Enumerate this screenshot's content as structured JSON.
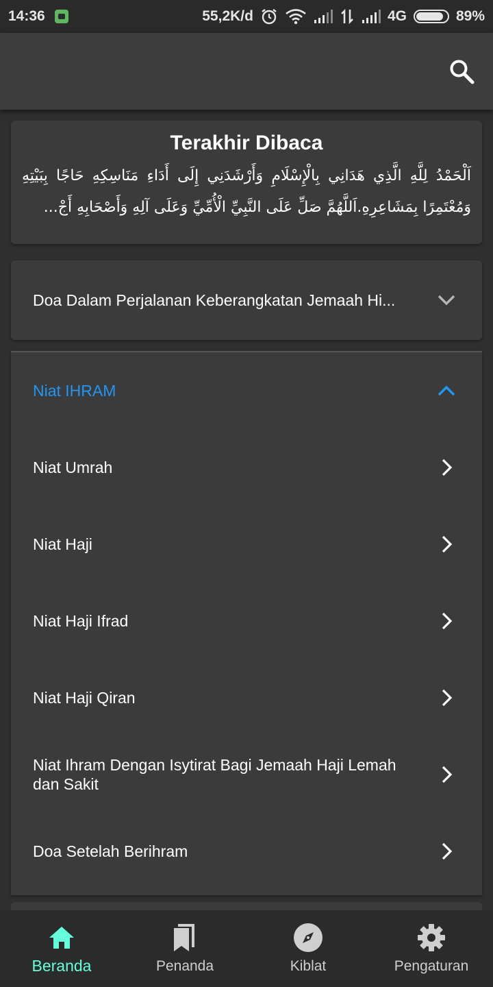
{
  "status_bar": {
    "time": "14:36",
    "network_speed": "55,2K/d",
    "network_type": "4G",
    "battery_percent": "89%",
    "battery_level": 0.89,
    "icons": [
      "app-notification-icon",
      "alarm-icon",
      "wifi-icon",
      "signal-icon",
      "data-transfer-icon",
      "signal-icon",
      "battery-icon"
    ]
  },
  "app_bar": {
    "search_icon": "search-icon"
  },
  "last_read": {
    "title": "Terakhir Dibaca",
    "text": "اَلْحَمْدُ لِلَّهِ الَّذِي هَدَانِي بِالْإِسْلَامِ وَأَرْشَدَنِي إِلَى أَدَاءِ مَنَاسِكِهِ حَاجًا بِبَيْتِهِ وَمُعْتَمِرًا بِمَشَاعِرِهِ.اَللَّهُمَّ صَلِّ عَلَى النَّبِيِّ الْأُمِّيِّ وَعَلَى آلِهِ وَأَصْحَابِهِ أَجْ..."
  },
  "sections": [
    {
      "title": "Doa Dalam Perjalanan Keberangkatan Jemaah Hi...",
      "expanded": false
    },
    {
      "title": "Niat IHRAM",
      "expanded": true,
      "accent_color": "#2196f3",
      "items": [
        "Niat Umrah",
        "Niat Haji",
        "Niat Haji Ifrad",
        "Niat Haji Qiran",
        "Niat Ihram Dengan Isytirat Bagi Jemaah Haji Lemah dan Sakit",
        "Doa Setelah Berihram"
      ]
    }
  ],
  "bottom_nav": {
    "active_color": "#64ffda",
    "items": [
      {
        "label": "Beranda",
        "icon": "home-icon",
        "active": true
      },
      {
        "label": "Penanda",
        "icon": "bookmark-icon",
        "active": false
      },
      {
        "label": "Kiblat",
        "icon": "compass-icon",
        "active": false
      },
      {
        "label": "Pengaturan",
        "icon": "gear-icon",
        "active": false
      }
    ]
  }
}
